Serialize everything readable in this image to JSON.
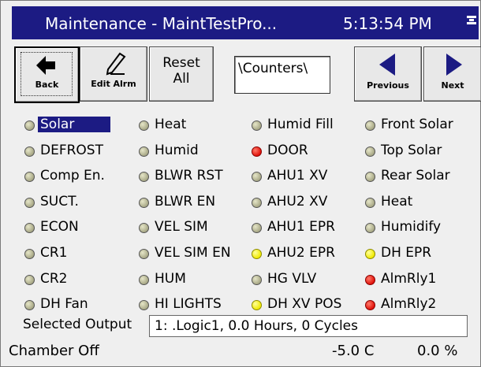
{
  "title": {
    "text": "Maintenance - MaintTestPro...",
    "time": "5:13:54 PM",
    "icon": "network-status-icon"
  },
  "toolbar": {
    "back_label": "Back",
    "edit_label": "Edit Alrm",
    "reset_label_line1": "Reset",
    "reset_label_line2": "All",
    "counter_path": "\\Counters\\",
    "previous_label": "Previous",
    "next_label": "Next",
    "colors": {
      "arrow": "#1c1b83"
    }
  },
  "outputs": {
    "col1": [
      {
        "label": "Solar",
        "state": "gray",
        "selected": true
      },
      {
        "label": "DEFROST",
        "state": "gray"
      },
      {
        "label": "Comp En.",
        "state": "gray"
      },
      {
        "label": "SUCT.",
        "state": "gray"
      },
      {
        "label": "ECON",
        "state": "gray"
      },
      {
        "label": "CR1",
        "state": "gray"
      },
      {
        "label": "CR2",
        "state": "gray"
      },
      {
        "label": "DH Fan",
        "state": "gray"
      }
    ],
    "col2": [
      {
        "label": "Heat",
        "state": "gray"
      },
      {
        "label": "Humid",
        "state": "gray"
      },
      {
        "label": "BLWR RST",
        "state": "gray"
      },
      {
        "label": "BLWR EN",
        "state": "gray"
      },
      {
        "label": "VEL SIM",
        "state": "gray"
      },
      {
        "label": "VEL SIM EN",
        "state": "gray"
      },
      {
        "label": "HUM",
        "state": "gray"
      },
      {
        "label": "HI LIGHTS",
        "state": "gray"
      }
    ],
    "col3": [
      {
        "label": "Humid Fill",
        "state": "gray"
      },
      {
        "label": "DOOR",
        "state": "red"
      },
      {
        "label": "AHU1 XV",
        "state": "gray"
      },
      {
        "label": "AHU2 XV",
        "state": "gray"
      },
      {
        "label": "AHU1 EPR",
        "state": "gray"
      },
      {
        "label": "AHU2 EPR",
        "state": "yellow"
      },
      {
        "label": "HG VLV",
        "state": "gray"
      },
      {
        "label": "DH XV POS",
        "state": "yellow"
      }
    ],
    "col4": [
      {
        "label": "Front Solar",
        "state": "gray"
      },
      {
        "label": "Top Solar",
        "state": "gray"
      },
      {
        "label": "Rear Solar",
        "state": "gray"
      },
      {
        "label": "Heat",
        "state": "gray"
      },
      {
        "label": "Humidify",
        "state": "gray"
      },
      {
        "label": "DH EPR",
        "state": "yellow"
      },
      {
        "label": "AlmRly1",
        "state": "red"
      },
      {
        "label": "AlmRly2",
        "state": "red"
      }
    ],
    "state_colors": {
      "gray": "#b4b490",
      "red": "#e1120a",
      "yellow": "#f0ea00"
    }
  },
  "selected_output": {
    "label": "Selected Output",
    "value": "1: .Logic1, 0.0 Hours, 0 Cycles"
  },
  "status": {
    "chamber": "Chamber Off",
    "temperature": "-5.0 C",
    "humidity": "0.0 %"
  }
}
